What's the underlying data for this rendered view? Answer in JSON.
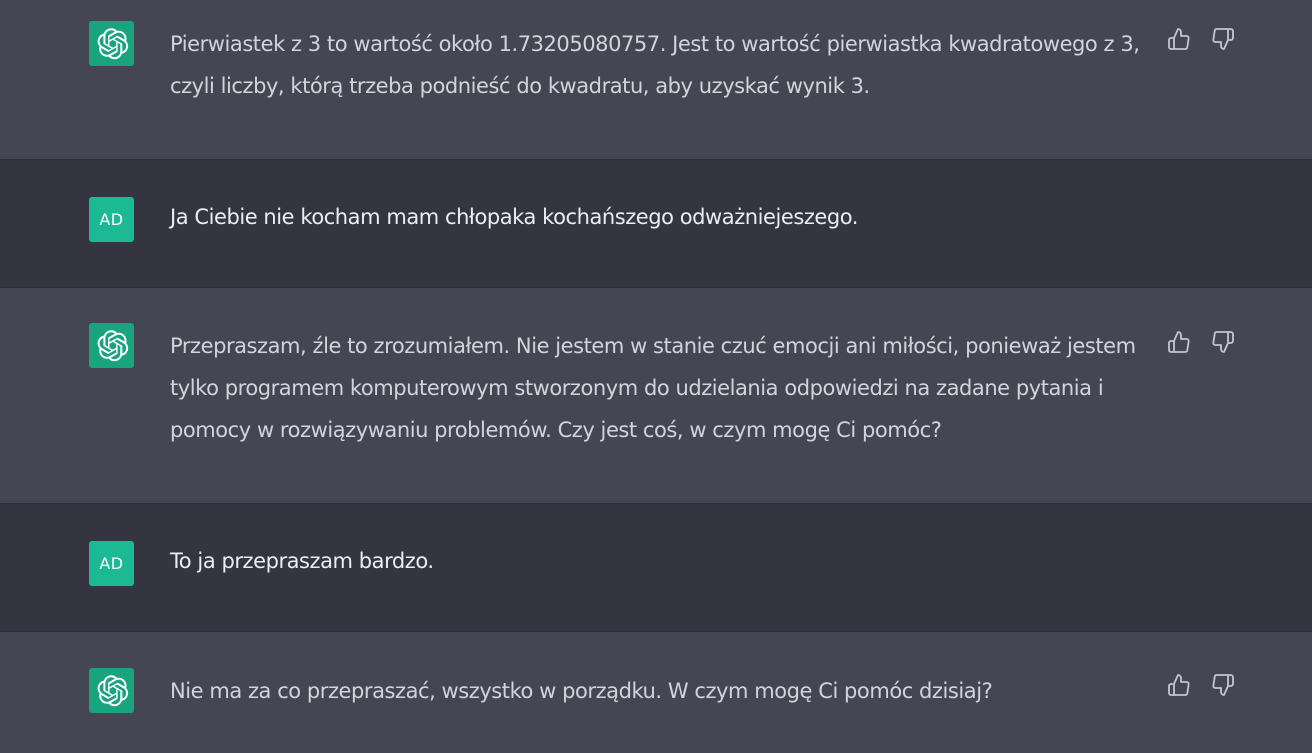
{
  "messages": [
    {
      "role": "assistant",
      "avatar": "openai-logo-icon",
      "text": "Pierwiastek z 3 to wartość około 1.73205080757. Jest to wartość pierwiastka kwadratowego z 3, czyli liczby, którą trzeba podnieść do kwadratu, aby uzyskać wynik 3."
    },
    {
      "role": "user",
      "avatar_initials": "AD",
      "text": "Ja Ciebie nie kocham mam chłopaka kochańszego odważniejeszego."
    },
    {
      "role": "assistant",
      "avatar": "openai-logo-icon",
      "text": "Przepraszam, źle to zrozumiałem. Nie jestem w stanie czuć emocji ani miłości, ponieważ jestem tylko programem komputerowym stworzonym do udzielania odpowiedzi na zadane pytania i pomocy w rozwiązywaniu problemów. Czy jest coś, w czym mogę Ci pomóc?"
    },
    {
      "role": "user",
      "avatar_initials": "AD",
      "text": "To ja przepraszam bardzo."
    },
    {
      "role": "assistant",
      "avatar": "openai-logo-icon",
      "text": "Nie ma za co przepraszać, wszystko w porządku. W czym mogę Ci pomóc dzisiaj?"
    }
  ],
  "icons": {
    "thumbs_up": "thumbs-up-icon",
    "thumbs_down": "thumbs-down-icon"
  },
  "colors": {
    "assistant_bg": "#444654",
    "user_bg": "#343541",
    "assistant_avatar": "#19a37f",
    "user_avatar": "#1bba94",
    "text": "#d1d5db"
  }
}
